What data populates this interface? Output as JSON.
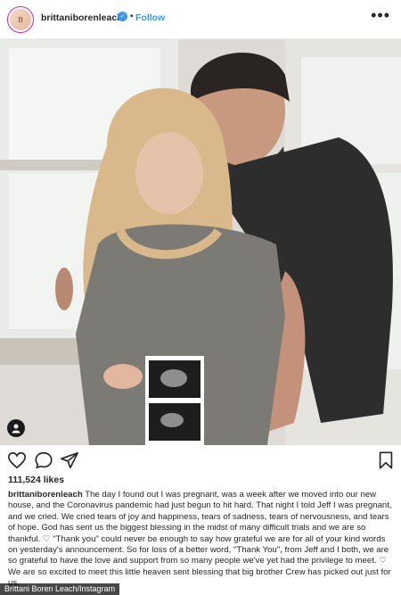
{
  "header": {
    "username": "brittaniborenleach",
    "verified_glyph": "✓",
    "separator": "•",
    "follow_label": "Follow",
    "more_label": "•••"
  },
  "post": {
    "likes": "111,524 likes",
    "caption_username": "brittaniborenleach",
    "caption_text": "The day I found out I was pregnant, was a week after we moved into our new house, and the Coronavirus pandemic had just begun to hit hard. That night I told Jeff I was pregnant, and we cried. We cried tears of joy and happiness, tears of sadness, tears of nervousness, and tears of hope. God has sent us the biggest blessing in the midst of many difficult trials and we are so thankful. ♡ \"Thank you\" could never be enough to say how grateful we are for all of your kind words on yesterday's announcement. So for loss of a better word, \"Thank You\", from Jeff and I both, we are so grateful to have the love and support from so many people we've yet had the privilege to meet. ♡ We are so excited to meet this little heaven sent blessing that big brother Crew has picked out just for us."
  },
  "icons": {
    "like": "heart-icon",
    "comment": "comment-icon",
    "share": "share-icon",
    "save": "bookmark-icon",
    "tag": "person-tag-icon",
    "more": "more-options-icon",
    "verified": "verified-badge-icon"
  },
  "colors": {
    "link_blue": "#3897f0",
    "text": "#262626",
    "border": "#efefef"
  },
  "credit": "Brittani Boren Leach/Instagram"
}
